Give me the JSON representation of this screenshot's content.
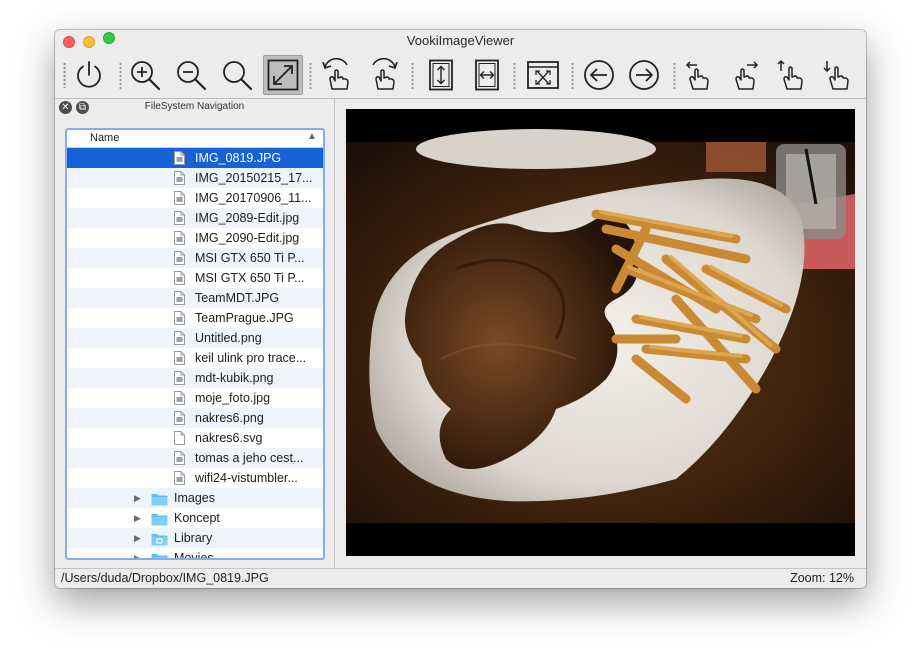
{
  "window": {
    "title": "VookiImageViewer"
  },
  "toolbar": {
    "buttons": [
      {
        "name": "power-button",
        "icon": "power-icon"
      },
      {
        "name": "zoom-in-button",
        "icon": "zoom-in-icon"
      },
      {
        "name": "zoom-out-button",
        "icon": "zoom-out-icon"
      },
      {
        "name": "zoom-reset-button",
        "icon": "magnifier-icon"
      },
      {
        "name": "fit-to-window-button",
        "icon": "expand-diagonal-icon",
        "active": true
      },
      {
        "name": "rotate-left-button",
        "icon": "rotate-left-hand-icon"
      },
      {
        "name": "rotate-right-button",
        "icon": "rotate-right-hand-icon"
      },
      {
        "name": "flip-vertical-button",
        "icon": "flip-vertical-icon"
      },
      {
        "name": "flip-horizontal-button",
        "icon": "flip-horizontal-icon"
      },
      {
        "name": "fullscreen-button",
        "icon": "fullscreen-window-icon"
      },
      {
        "name": "previous-image-button",
        "icon": "arrow-left-circle-icon"
      },
      {
        "name": "next-image-button",
        "icon": "arrow-right-circle-icon"
      },
      {
        "name": "gesture-swipe-left-button",
        "icon": "hand-swipe-left-icon"
      },
      {
        "name": "gesture-swipe-right-button",
        "icon": "hand-swipe-right-icon"
      },
      {
        "name": "gesture-swipe-up-button",
        "icon": "hand-swipe-up-icon"
      },
      {
        "name": "gesture-swipe-down-button",
        "icon": "hand-swipe-down-icon"
      }
    ]
  },
  "navigation": {
    "title": "FileSystem Navigation",
    "column_name": "Name",
    "sort_indicator": "▲",
    "files": [
      {
        "name": "IMG_0819.JPG",
        "type": "image",
        "selected": true
      },
      {
        "name": "IMG_20150215_17...",
        "type": "image"
      },
      {
        "name": "IMG_20170906_11...",
        "type": "image"
      },
      {
        "name": "IMG_2089-Edit.jpg",
        "type": "image"
      },
      {
        "name": "IMG_2090-Edit.jpg",
        "type": "image"
      },
      {
        "name": "MSI GTX 650 Ti P...",
        "type": "image"
      },
      {
        "name": "MSI GTX 650 Ti P...",
        "type": "image"
      },
      {
        "name": "TeamMDT.JPG",
        "type": "image"
      },
      {
        "name": "TeamPrague.JPG",
        "type": "image"
      },
      {
        "name": "Untitled.png",
        "type": "image"
      },
      {
        "name": "keil ulink pro trace...",
        "type": "image"
      },
      {
        "name": "mdt-kubik.png",
        "type": "image"
      },
      {
        "name": "moje_foto.jpg",
        "type": "image"
      },
      {
        "name": "nakres6.png",
        "type": "image"
      },
      {
        "name": "nakres6.svg",
        "type": "document"
      },
      {
        "name": "tomas a jeho cest...",
        "type": "image"
      },
      {
        "name": "wifi24-vistumbler...",
        "type": "image"
      }
    ],
    "folders": [
      {
        "name": "Images",
        "icon": "folder-icon"
      },
      {
        "name": "Koncept",
        "icon": "folder-icon"
      },
      {
        "name": "Library",
        "icon": "library-folder-icon"
      },
      {
        "name": "Movies",
        "icon": "movies-folder-icon"
      }
    ]
  },
  "status": {
    "path": "/Users/duda/Dropbox/IMG_0819.JPG",
    "zoom": "Zoom: 12%"
  },
  "colors": {
    "selection": "#1661d6",
    "tree_focus_border": "#80aef0",
    "folder": "#5ec0f2"
  }
}
